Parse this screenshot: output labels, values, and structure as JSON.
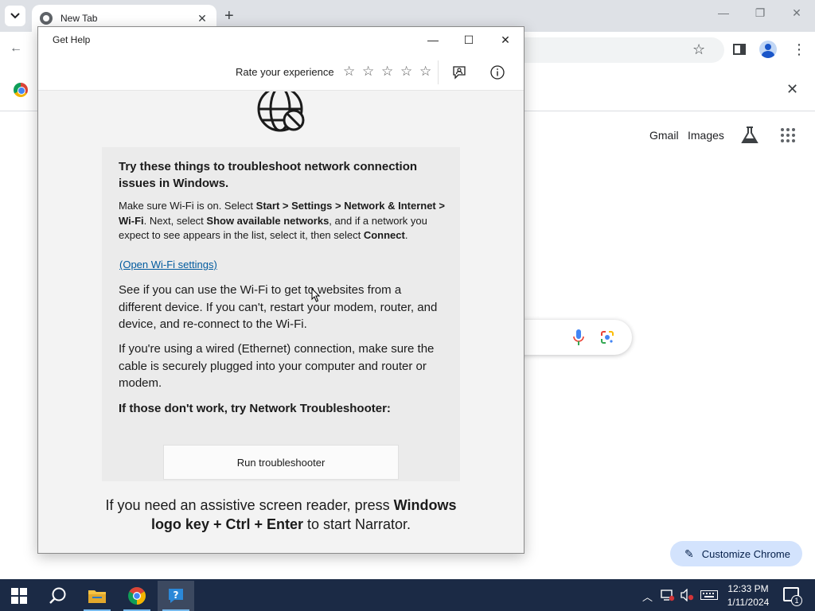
{
  "chrome": {
    "tab_title": "New Tab",
    "new_tab_symbol": "+",
    "links": {
      "gmail": "Gmail",
      "images": "Images"
    },
    "customize_label": "Customize Chrome",
    "icons": [
      "tab-search-icon",
      "chrome-favicon",
      "tab-close-icon",
      "new-tab-icon",
      "minimize-icon",
      "restore-icon",
      "close-icon",
      "back-icon",
      "star-icon",
      "side-panel-icon",
      "profile-icon",
      "menu-icon",
      "chrome-logo-icon",
      "infobar-close-icon",
      "labs-icon",
      "apps-icon",
      "mic-icon",
      "lens-icon",
      "pencil-icon"
    ]
  },
  "get_help": {
    "title": "Get Help",
    "rate_label": "Rate your experience",
    "stars": [
      "☆",
      "☆",
      "☆",
      "☆",
      "☆"
    ],
    "heading": "Try these things to troubleshoot network connection issues in Windows.",
    "p1_parts": [
      "Make sure Wi-Fi is on. Select ",
      "Start > Settings > Network & Internet > Wi-Fi",
      ". Next, select ",
      "Show available networks",
      ", and if a network you expect to see appears in the list, select it, then select ",
      "Connect",
      "."
    ],
    "link": "(Open Wi-Fi settings)",
    "p2": "See if you can use the Wi-Fi to get to websites from a different device. If you can't, restart your modem, router, and device, and re-connect to the Wi-Fi.",
    "p3": "If you're using a wired (Ethernet) connection, make sure the cable is securely plugged into your computer and router or modem.",
    "p4": "If those don't work, try Network Troubleshooter:",
    "run_button": "Run troubleshooter",
    "footer_parts": [
      "If you need an assistive screen reader, press ",
      "Windows logo key + Ctrl + Enter",
      " to start Narrator."
    ],
    "icons": [
      "feedback-icon",
      "info-icon",
      "globe-blocked-icon"
    ]
  },
  "taskbar": {
    "time": "12:33 PM",
    "date": "1/11/2024",
    "notification_count": "1",
    "apps": [
      "file-explorer",
      "chrome",
      "get-help"
    ],
    "accent": "#1b2a45"
  }
}
